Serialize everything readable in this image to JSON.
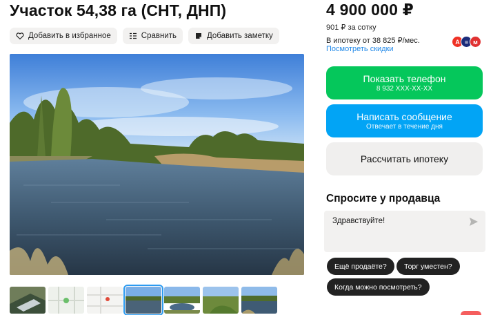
{
  "listing": {
    "title": "Участок 54,38 га (СНТ, ДНП)"
  },
  "actions": {
    "favorite_label": "Добавить в избранное",
    "compare_label": "Сравнить",
    "note_label": "Добавить заметку"
  },
  "pricing": {
    "price": "4 900 000 ₽",
    "per_unit": "901 ₽ за сотку",
    "mortgage": "В ипотеку от 38 825 ₽/мес.",
    "discount_link": "Посмотреть скидки"
  },
  "banks": [
    {
      "icon": "alfa-bank-icon",
      "letter": "А",
      "color": "#ef3124"
    },
    {
      "icon": "bank-icon",
      "letter": "≡",
      "color": "#1b2b7a"
    },
    {
      "icon": "bank-icon-2",
      "letter": "м",
      "color": "#e03131"
    }
  ],
  "buttons": {
    "show_phone": "Показать телефон",
    "phone_masked": "8 932 XXX-XX-XX",
    "write_message": "Написать сообщение",
    "reply_time": "Отвечает в течение дня",
    "calc_mortgage": "Рассчитать ипотеку"
  },
  "ask": {
    "title": "Спросите у продавца",
    "message": "Здравствуйте!",
    "quick_questions": [
      "Ещё продаёте?",
      "Торг уместен?",
      "Когда можно посмотреть?"
    ]
  },
  "colors": {
    "phone_button": "#05c75b",
    "message_button": "#02a4f5",
    "link": "#1e87e8",
    "thumb_active": "#2d9bf0"
  }
}
